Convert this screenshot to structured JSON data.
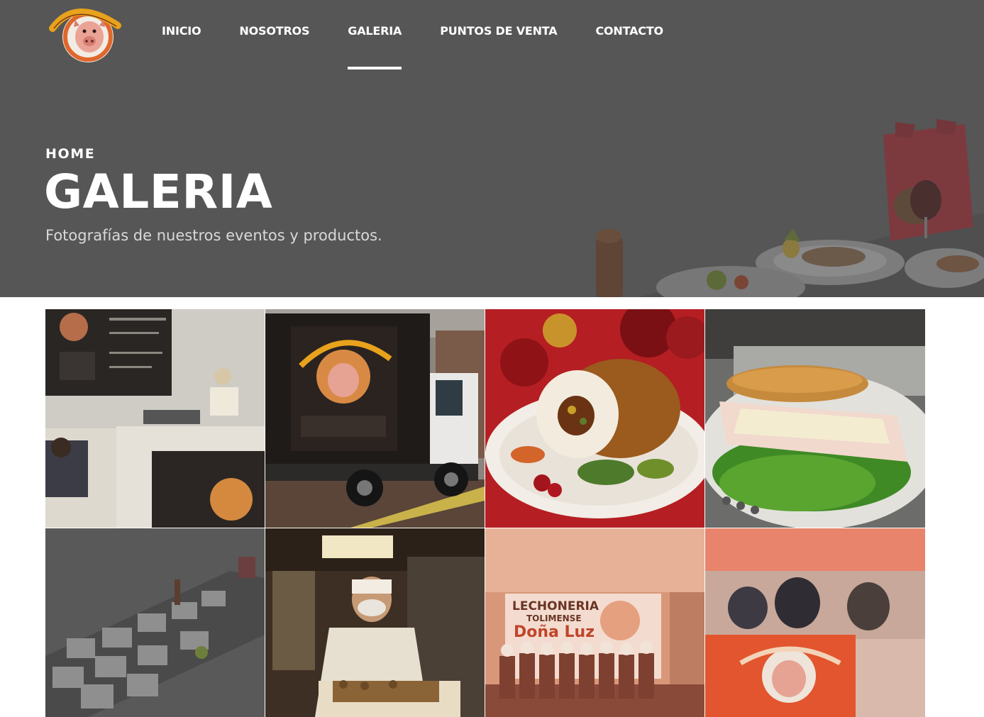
{
  "brand": {
    "logo_text": "lechoneria doña luz"
  },
  "nav": {
    "items": [
      {
        "label": "INICIO",
        "active": false
      },
      {
        "label": "NOSOTROS",
        "active": false
      },
      {
        "label": "GALERIA",
        "active": true
      },
      {
        "label": "PUNTOS DE VENTA",
        "active": false
      },
      {
        "label": "CONTACTO",
        "active": false
      }
    ]
  },
  "hero": {
    "breadcrumb": "HOME",
    "title": "GALERIA",
    "subtitle": "Fotografías de nuestros eventos y productos."
  },
  "gallery": {
    "tiles": [
      {
        "subject": "store-counter"
      },
      {
        "subject": "delivery-truck"
      },
      {
        "subject": "stuffed-roast-plate"
      },
      {
        "subject": "sandwich-plate"
      },
      {
        "subject": "buffet-table"
      },
      {
        "subject": "kitchen-worker"
      },
      {
        "subject": "team-photo",
        "sign_line1": "LECHONERIA",
        "sign_line2": "TOLIMENSE",
        "sign_line3": "Doña Luz"
      },
      {
        "subject": "restaurant-box"
      }
    ]
  },
  "colors": {
    "hero_bg": "#565656",
    "nav_text": "#ffffff",
    "accent_orange": "#e0672b",
    "brand_gold": "#e8a21c"
  }
}
